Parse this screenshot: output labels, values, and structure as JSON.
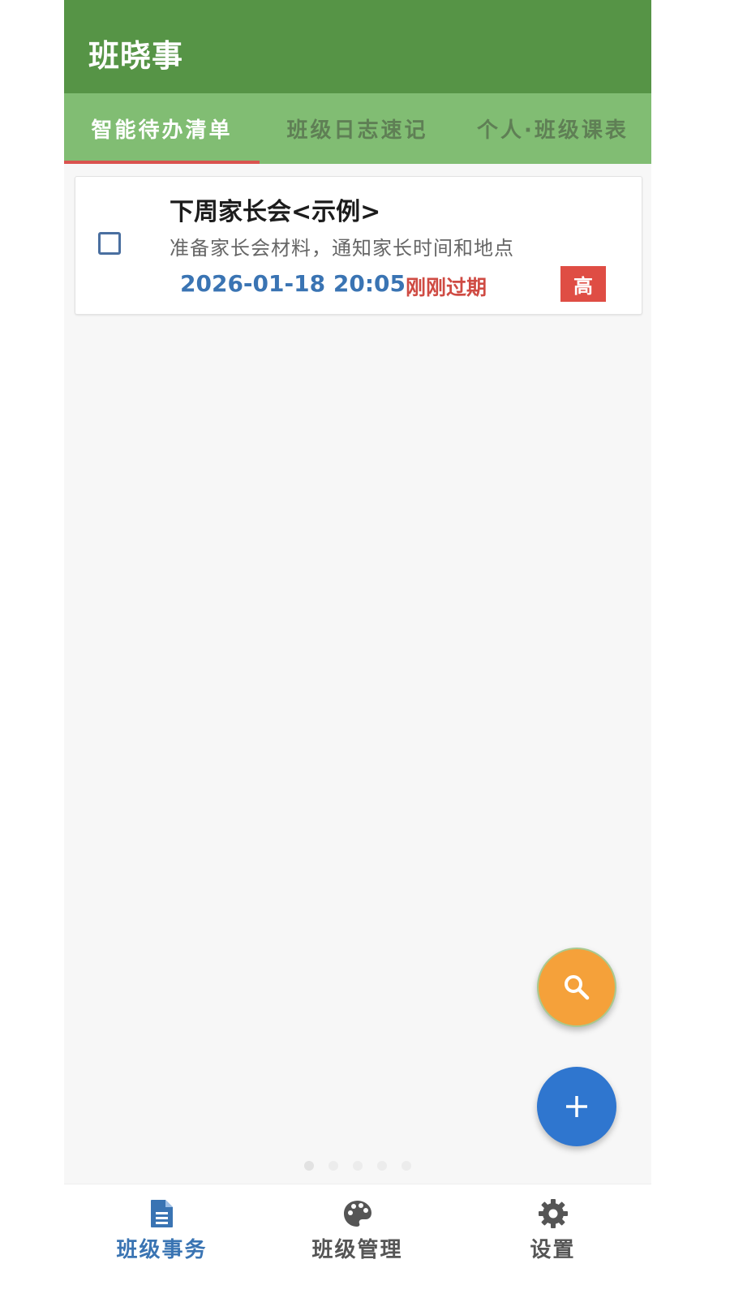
{
  "app": {
    "title": "班晓事"
  },
  "tabs": [
    {
      "label": "智能待办清单",
      "active": true
    },
    {
      "label": "班级日志速记",
      "active": false
    },
    {
      "label": "个人·班级课表",
      "active": false
    }
  ],
  "todos": [
    {
      "title": "下周家长会<示例>",
      "description": "准备家长会材料，通知家长时间和地点",
      "datetime": "2026-01-18 20:05",
      "status": "刚刚过期",
      "priority": "高",
      "checked": false
    }
  ],
  "fabs": {
    "search_icon": "search-icon",
    "add_icon": "plus-icon"
  },
  "page_indicator": {
    "count": 5,
    "current": 1
  },
  "bottom_nav": [
    {
      "label": "班级事务",
      "icon": "document-icon",
      "active": true
    },
    {
      "label": "班级管理",
      "icon": "palette-icon",
      "active": false
    },
    {
      "label": "设置",
      "icon": "gear-icon",
      "active": false
    }
  ],
  "colors": {
    "topbar": "#569446",
    "tabbar": "#81bd73",
    "tab_indicator": "#d9534f",
    "accent_blue": "#3a74b3",
    "overdue_red": "#cf4b43",
    "priority_high": "#df4d44",
    "fab_search": "#f5a13a",
    "fab_add": "#2f76cf"
  }
}
